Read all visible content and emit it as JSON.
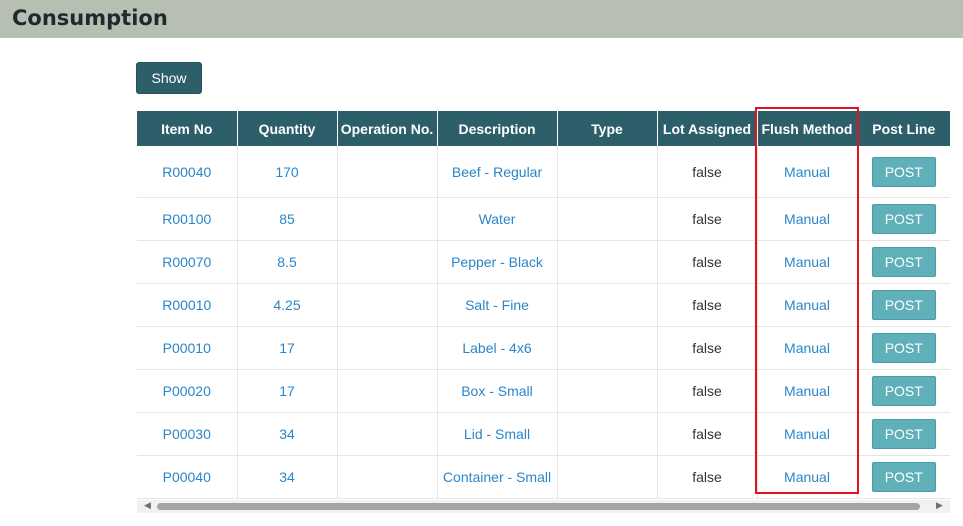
{
  "page": {
    "title": "Consumption"
  },
  "toolbar": {
    "show_label": "Show"
  },
  "table": {
    "columns": [
      "Item No",
      "Quantity",
      "Operation No.",
      "Description",
      "Type",
      "Lot Assigned",
      "Flush Method",
      "Post Line"
    ],
    "rows": [
      {
        "item_no": "R00040",
        "quantity": "170",
        "operation_no": "",
        "description": "Beef - Regular",
        "type": "",
        "lot_assigned": "false",
        "flush_method": "Manual",
        "post_label": "POST"
      },
      {
        "item_no": "R00100",
        "quantity": "85",
        "operation_no": "",
        "description": "Water",
        "type": "",
        "lot_assigned": "false",
        "flush_method": "Manual",
        "post_label": "POST"
      },
      {
        "item_no": "R00070",
        "quantity": "8.5",
        "operation_no": "",
        "description": "Pepper - Black",
        "type": "",
        "lot_assigned": "false",
        "flush_method": "Manual",
        "post_label": "POST"
      },
      {
        "item_no": "R00010",
        "quantity": "4.25",
        "operation_no": "",
        "description": "Salt - Fine",
        "type": "",
        "lot_assigned": "false",
        "flush_method": "Manual",
        "post_label": "POST"
      },
      {
        "item_no": "P00010",
        "quantity": "17",
        "operation_no": "",
        "description": "Label - 4x6",
        "type": "",
        "lot_assigned": "false",
        "flush_method": "Manual",
        "post_label": "POST"
      },
      {
        "item_no": "P00020",
        "quantity": "17",
        "operation_no": "",
        "description": "Box - Small",
        "type": "",
        "lot_assigned": "false",
        "flush_method": "Manual",
        "post_label": "POST"
      },
      {
        "item_no": "P00030",
        "quantity": "34",
        "operation_no": "",
        "description": "Lid - Small",
        "type": "",
        "lot_assigned": "false",
        "flush_method": "Manual",
        "post_label": "POST"
      },
      {
        "item_no": "P00040",
        "quantity": "34",
        "operation_no": "",
        "description": "Container - Small",
        "type": "",
        "lot_assigned": "false",
        "flush_method": "Manual",
        "post_label": "POST"
      }
    ]
  },
  "scrollbar": {
    "left_icon": "triangle-left-icon",
    "right_icon": "triangle-right-icon"
  },
  "colors": {
    "header_bar": "#b6bfb1",
    "table_header": "#2d5f6b",
    "link": "#2a86c9",
    "post_button": "#5fb0b9",
    "highlight": "#e0141e"
  }
}
